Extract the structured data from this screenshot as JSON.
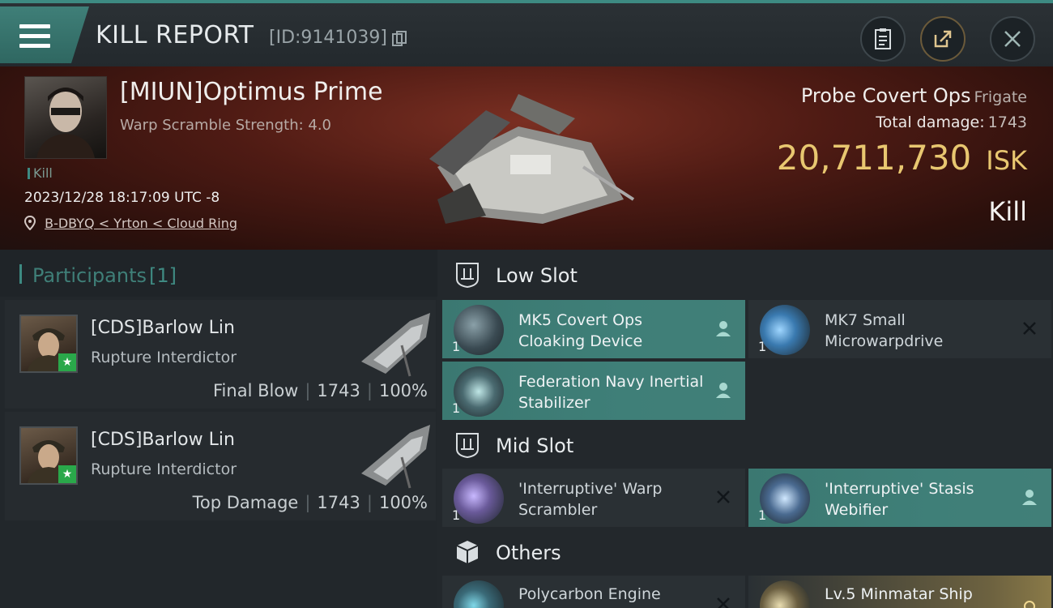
{
  "header": {
    "title": "KILL REPORT",
    "id_text": "[ID:9141039]",
    "menu_icon": "hamburger-icon",
    "buttons": [
      "clipboard-icon",
      "share-icon",
      "close-icon"
    ]
  },
  "victim": {
    "name": "[MIUN]Optimus Prime",
    "warp_strength": "Warp Scramble Strength: 4.0",
    "tag": "Kill",
    "timestamp": "2023/12/28 18:17:09 UTC -8",
    "location": "B-DBYQ < Yrton < Cloud Ring",
    "ship": "Probe Covert Ops",
    "ship_class": "Frigate",
    "total_damage_label": "Total damage:",
    "total_damage": "1743",
    "isk_value": "20,711,730",
    "isk_unit": "ISK",
    "result": "Kill"
  },
  "participants": {
    "label": "Participants",
    "count": "[1]",
    "rows": [
      {
        "name": "[CDS]Barlow Lin",
        "ship": "Rupture Interdictor",
        "role": "Final Blow",
        "damage": "1743",
        "percent": "100%"
      },
      {
        "name": "[CDS]Barlow Lin",
        "ship": "Rupture Interdictor",
        "role": "Top Damage",
        "damage": "1743",
        "percent": "100%"
      }
    ]
  },
  "fitting": {
    "low_slot": {
      "label": "Low Slot",
      "modules": [
        {
          "name": "MK5 Covert Ops Cloaking Device",
          "qty": "1",
          "status": "person"
        },
        {
          "name": "MK7 Small Microwarpdrive",
          "qty": "1",
          "status": "destroyed"
        },
        {
          "name": "Federation Navy Inertial Stabilizer",
          "qty": "1",
          "status": "person"
        }
      ]
    },
    "mid_slot": {
      "label": "Mid Slot",
      "modules": [
        {
          "name": "'Interruptive' Warp Scrambler",
          "qty": "1",
          "status": "destroyed"
        },
        {
          "name": "'Interruptive' Stasis Webifier",
          "qty": "1",
          "status": "person"
        }
      ]
    },
    "others": {
      "label": "Others",
      "modules": [
        {
          "name": "Polycarbon Engine",
          "qty": "",
          "status": "destroyed"
        },
        {
          "name": "Lv.5 Minmatar Ship",
          "qty": "",
          "status": "gold"
        }
      ]
    }
  },
  "colors": {
    "accent_teal": "#3f7f78",
    "isk_gold": "#e8c770",
    "banner_red": "#5a1f16"
  }
}
